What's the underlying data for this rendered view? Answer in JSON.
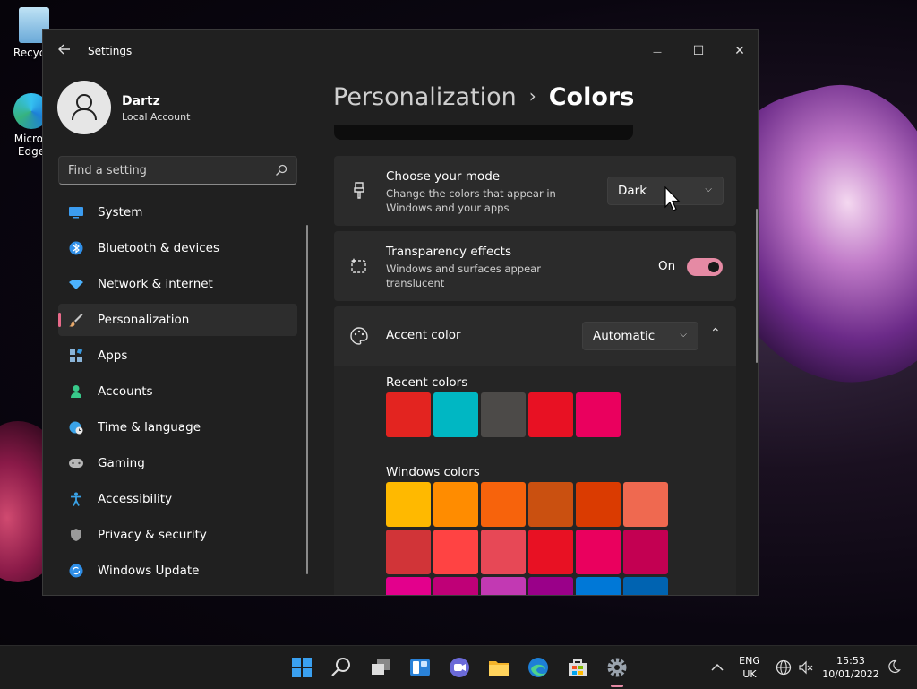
{
  "desktop": {
    "icons": [
      {
        "label": "Recycle"
      },
      {
        "label": "Micros Edge"
      }
    ]
  },
  "window": {
    "title": "Settings",
    "back_icon": "back-arrow-icon",
    "controls": {
      "minimize": "—",
      "maximize": "☐",
      "close": "✕"
    }
  },
  "profile": {
    "name": "Dartz",
    "account_type": "Local Account"
  },
  "search": {
    "placeholder": "Find a setting"
  },
  "nav": [
    {
      "label": "System",
      "icon": "monitor-icon",
      "color": "#3b9cf0"
    },
    {
      "label": "Bluetooth & devices",
      "icon": "bluetooth-icon",
      "color": "#2f8fe8"
    },
    {
      "label": "Network & internet",
      "icon": "wifi-icon",
      "color": "#4cb3ff"
    },
    {
      "label": "Personalization",
      "icon": "brush-icon",
      "color": "#e7a86a",
      "active": true
    },
    {
      "label": "Apps",
      "icon": "apps-icon",
      "color": "#8ab4d8"
    },
    {
      "label": "Accounts",
      "icon": "person-icon",
      "color": "#38c98a"
    },
    {
      "label": "Time & language",
      "icon": "globe-clock-icon",
      "color": "#3aa3e8"
    },
    {
      "label": "Gaming",
      "icon": "gamepad-icon",
      "color": "#b8b8b8"
    },
    {
      "label": "Accessibility",
      "icon": "accessibility-icon",
      "color": "#3aa3e8"
    },
    {
      "label": "Privacy & security",
      "icon": "shield-icon",
      "color": "#9a9a9a"
    },
    {
      "label": "Windows Update",
      "icon": "update-icon",
      "color": "#2f8fe8"
    }
  ],
  "breadcrumb": {
    "parent": "Personalization",
    "separator": "›",
    "current": "Colors"
  },
  "mode_card": {
    "title": "Choose your mode",
    "desc": "Change the colors that appear in Windows and your apps",
    "value": "Dark"
  },
  "transparency_card": {
    "title": "Transparency effects",
    "desc": "Windows and surfaces appear translucent",
    "state": "On"
  },
  "accent_card": {
    "title": "Accent color",
    "value": "Automatic",
    "collapse_glyph": "⌃"
  },
  "recent_colors": {
    "label": "Recent colors",
    "swatches": [
      "#e32420",
      "#00b7c3",
      "#4c4a48",
      "#e81123",
      "#ea005e"
    ]
  },
  "windows_colors": {
    "label": "Windows colors",
    "rows": [
      [
        "#ffb900",
        "#ff8c00",
        "#f7630c",
        "#ca5010",
        "#da3b01",
        "#ef6950"
      ],
      [
        "#d13438",
        "#ff4343",
        "#e74856",
        "#e81123",
        "#ea005e",
        "#c30052"
      ],
      [
        "#e3008c",
        "#bf0077",
        "#c239b3",
        "#9a0089",
        "#0078d7",
        "#0063b1"
      ]
    ]
  },
  "taskbar": {
    "icons": [
      "start-icon",
      "search-icon",
      "task-view-icon",
      "widgets-icon",
      "chat-icon",
      "file-explorer-icon",
      "edge-icon",
      "store-icon",
      "settings-icon"
    ],
    "lang_line1": "ENG",
    "lang_line2": "UK",
    "time": "15:53",
    "date": "10/01/2022"
  }
}
